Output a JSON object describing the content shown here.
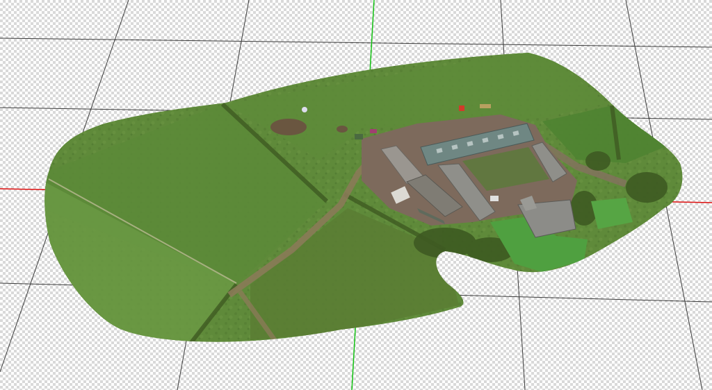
{
  "viewer": {
    "axis_colors": {
      "x": "#e01010",
      "y": "#10c010"
    },
    "grid_color": "#3a3a3a",
    "background": "checkerboard"
  },
  "model": {
    "colors": {
      "field_main": "#5f8a3a",
      "field_dark": "#4a6e2c",
      "field_light": "#6e9a46",
      "track": "#8a7a58",
      "yard": "#7d6a5c",
      "roof_green": "#6f8783",
      "roof_grey": "#8f8f8a",
      "lawn": "#4fa040",
      "hedge": "#3e5a22"
    }
  }
}
